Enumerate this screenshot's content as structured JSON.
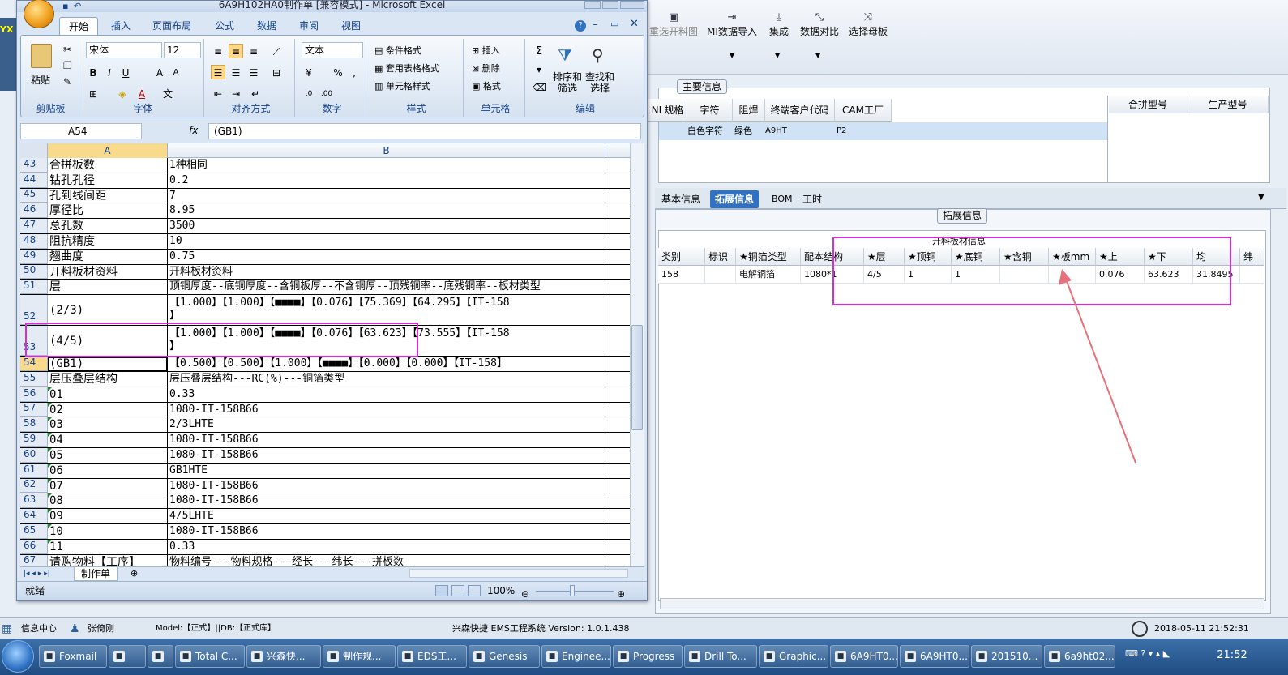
{
  "background_app": {
    "toolbar": [
      {
        "label": "重选开料图",
        "icon": "image-icon"
      },
      {
        "label": "MI数据导入",
        "icon": "import-icon"
      },
      {
        "label": "集成",
        "icon": "download-icon"
      },
      {
        "label": "数据对比",
        "icon": "compare-icon"
      },
      {
        "label": "选择母板",
        "icon": "shuffle-icon"
      }
    ],
    "main_group_title": "主要信息",
    "main_grid": {
      "headers": [
        "NL规格",
        "字符",
        "阻焊",
        "终端客户代码",
        "CAM工厂"
      ],
      "row": [
        "",
        "白色字符",
        "绿色",
        "A9HT",
        "P2"
      ],
      "right_headers": [
        "合拼型号",
        "生产型号"
      ]
    },
    "tabs": [
      "基本信息",
      "拓展信息",
      "BOM",
      "工时"
    ],
    "active_tab": "拓展信息",
    "ext_title": "拓展信息",
    "material_grid": {
      "caption": "开料板材信息",
      "headers": [
        "类别",
        "标识",
        "★铜箔类型",
        "配本结构",
        "★层",
        "★顶铜",
        "★底铜",
        "★含铜mm",
        "★板mm",
        "★上",
        "★下",
        "均",
        "纬"
      ],
      "row": [
        "158",
        "",
        "电解铜箔",
        "1080*1",
        "4/5",
        "1",
        "1",
        "",
        "",
        "0.076",
        "63.623",
        "31.8495",
        ""
      ]
    },
    "status": {
      "info_center": "信息中心",
      "user": "张倚刚",
      "model": "Model:【正式】||DB:【正式库】",
      "system": "兴森快捷 EMS工程系统 Version: 1.0.1.438",
      "datetime": "2018-05-11 21:52:31"
    }
  },
  "excel": {
    "title": "6A9H102HA0制作单 [兼容模式] - Microsoft Excel",
    "ribbon_tabs": [
      "开始",
      "插入",
      "页面布局",
      "公式",
      "数据",
      "审阅",
      "视图"
    ],
    "active_ribbon_tab": "开始",
    "groups": {
      "clipboard": {
        "label": "剪贴板",
        "paste": "粘贴"
      },
      "font": {
        "label": "字体",
        "font_name": "宋体",
        "font_size": "12"
      },
      "alignment": {
        "label": "对齐方式"
      },
      "number": {
        "label": "数字",
        "format": "文本"
      },
      "styles": {
        "label": "样式",
        "items": [
          "条件格式",
          "套用表格格式",
          "单元格样式"
        ]
      },
      "cells": {
        "label": "单元格",
        "items": [
          "插入",
          "删除",
          "格式"
        ]
      },
      "editing": {
        "label": "编辑",
        "sort": "排序和\n筛选",
        "find": "查找和\n选择"
      }
    },
    "name_box": "A54",
    "formula": "(GB1)",
    "columns": [
      "A",
      "B"
    ],
    "rows": [
      {
        "n": "43",
        "a": "合拼板数",
        "b": "1种相同"
      },
      {
        "n": "44",
        "a": "钻孔孔径",
        "b": "0.2"
      },
      {
        "n": "45",
        "a": "孔到线间距",
        "b": "7"
      },
      {
        "n": "46",
        "a": "厚径比",
        "b": "8.95"
      },
      {
        "n": "47",
        "a": "总孔数",
        "b": "3500"
      },
      {
        "n": "48",
        "a": "阻抗精度",
        "b": "10"
      },
      {
        "n": "49",
        "a": "翘曲度",
        "b": "0.75"
      },
      {
        "n": "50",
        "a": "开料板材资料",
        "b": "开料板材资料"
      },
      {
        "n": "51",
        "a": "层",
        "b": "顶铜厚度--底铜厚度--含铜板厚--不含铜厚--顶残铜率--底残铜率--板材类型"
      },
      {
        "n": "52",
        "a": "(2/3)",
        "b": "【1.000】【1.000】【■■■■】【0.076】【75.369】【64.295】【IT-158\n】"
      },
      {
        "n": "53",
        "a": "(4/5)",
        "b": "【1.000】【1.000】【■■■■】【0.076】【63.623】【73.555】【IT-158\n】"
      },
      {
        "n": "54",
        "a": "(GB1)",
        "b": "【0.500】【0.500】【1.000】【■■■■】【0.000】【0.000】【IT-158】"
      },
      {
        "n": "55",
        "a": "层压叠层结构",
        "b": "层压叠层结构---RC(%)---铜箔类型"
      },
      {
        "n": "56",
        "a": "01",
        "b": "0.33"
      },
      {
        "n": "57",
        "a": "02",
        "b": "1080-IT-158B66"
      },
      {
        "n": "58",
        "a": "03",
        "b": "2/3LHTE"
      },
      {
        "n": "59",
        "a": "04",
        "b": "1080-IT-158B66"
      },
      {
        "n": "60",
        "a": "05",
        "b": "1080-IT-158B66"
      },
      {
        "n": "61",
        "a": "06",
        "b": "GB1HTE"
      },
      {
        "n": "62",
        "a": "07",
        "b": "1080-IT-158B66"
      },
      {
        "n": "63",
        "a": "08",
        "b": "1080-IT-158B66"
      },
      {
        "n": "64",
        "a": "09",
        "b": "4/5LHTE"
      },
      {
        "n": "65",
        "a": "10",
        "b": "1080-IT-158B66"
      },
      {
        "n": "66",
        "a": "11",
        "b": "0.33"
      },
      {
        "n": "67",
        "a": "请购物料【工序】",
        "b": "物料编号---物料规格---经长---纬长---拼板数"
      }
    ],
    "sheet_tab": "制作单",
    "status_ready": "就绪",
    "zoom": "100%"
  },
  "taskbar": {
    "items": [
      "Foxmail",
      "",
      "",
      "Total C...",
      "兴森快...",
      "制作规...",
      "EDS工...",
      "Genesis",
      "Enginee...",
      "Progress",
      "Drill To...",
      "Graphic...",
      "6A9HT0...",
      "6A9HT0...",
      "201510...",
      "6a9ht02..."
    ],
    "time": "21:52"
  },
  "colors": {
    "annotation": "#d42fd4",
    "arrow": "#e8707a",
    "accent": "#2f72c4"
  }
}
